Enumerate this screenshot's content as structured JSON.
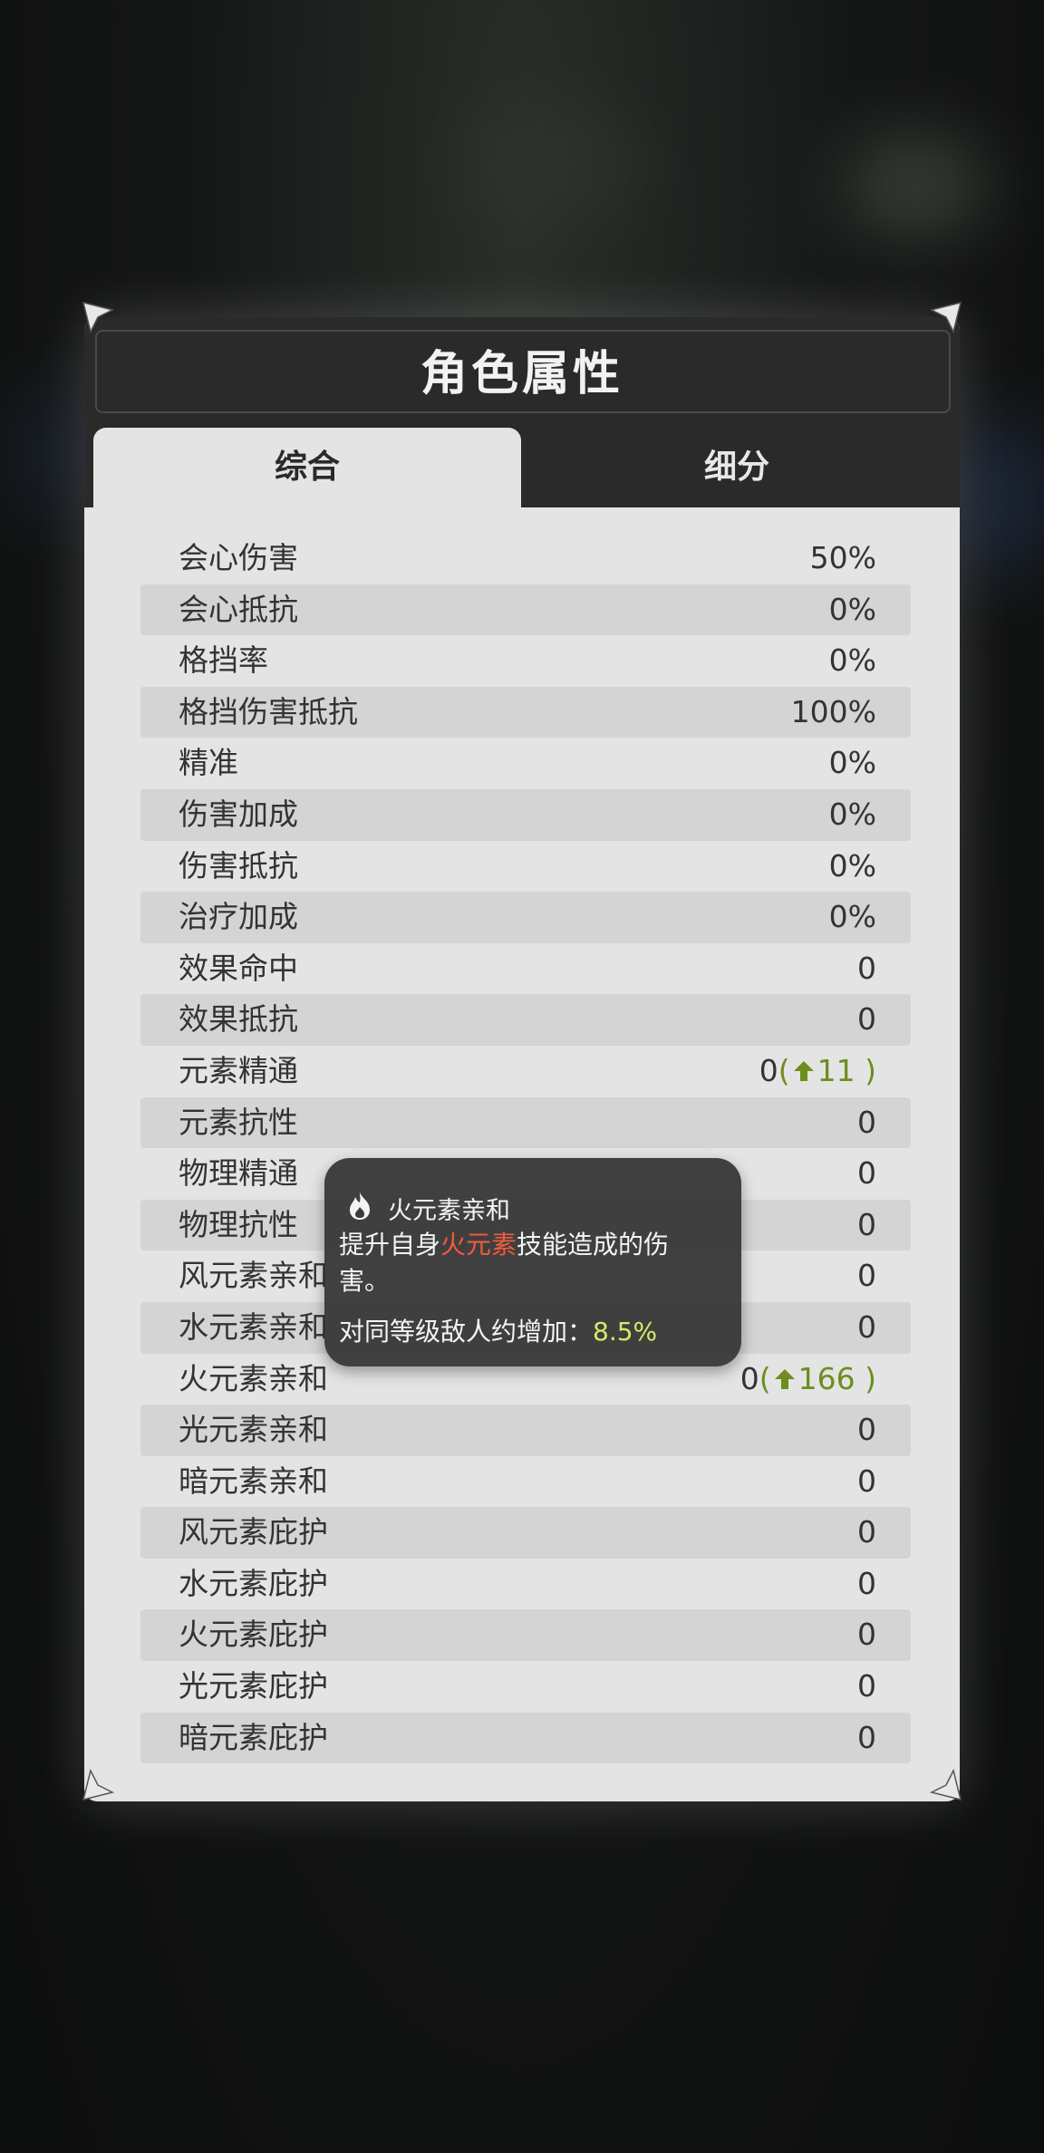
{
  "panel": {
    "title": "角色属性",
    "tabs": [
      {
        "label": "综合",
        "active": true
      },
      {
        "label": "细分",
        "active": false
      }
    ]
  },
  "stats": [
    {
      "label": "会心伤害",
      "value": "50%"
    },
    {
      "label": "会心抵抗",
      "value": "0%"
    },
    {
      "label": "格挡率",
      "value": "0%"
    },
    {
      "label": "格挡伤害抵抗",
      "value": "100%"
    },
    {
      "label": "精准",
      "value": "0%"
    },
    {
      "label": "伤害加成",
      "value": "0%"
    },
    {
      "label": "伤害抵抗",
      "value": "0%"
    },
    {
      "label": "治疗加成",
      "value": "0%"
    },
    {
      "label": "效果命中",
      "value": "0"
    },
    {
      "label": "效果抵抗",
      "value": "0"
    },
    {
      "label": "元素精通",
      "value": "0",
      "bonus": "11"
    },
    {
      "label": "元素抗性",
      "value": "0"
    },
    {
      "label": "物理精通",
      "value": "0"
    },
    {
      "label": "物理抗性",
      "value": "0"
    },
    {
      "label": "风元素亲和",
      "value": "0"
    },
    {
      "label": "水元素亲和",
      "value": "0"
    },
    {
      "label": "火元素亲和",
      "value": "0",
      "bonus": "166"
    },
    {
      "label": "光元素亲和",
      "value": "0"
    },
    {
      "label": "暗元素亲和",
      "value": "0"
    },
    {
      "label": "风元素庇护",
      "value": "0"
    },
    {
      "label": "水元素庇护",
      "value": "0"
    },
    {
      "label": "火元素庇护",
      "value": "0"
    },
    {
      "label": "光元素庇护",
      "value": "0"
    },
    {
      "label": "暗元素庇护",
      "value": "0"
    }
  ],
  "tooltip": {
    "icon": "fire-icon",
    "title": "火元素亲和",
    "desc_prefix": "提升自身",
    "desc_highlight": "火元素",
    "desc_suffix": "技能造成的伤害。",
    "line_label": "对同等级敌人约增加：",
    "line_value": "8.5%"
  },
  "colors": {
    "bonus": "#6d8e1d",
    "fire_highlight": "#f05a3c",
    "tooltip_value": "#d9e86a",
    "header_bg": "#2a2a2a",
    "panel_bg": "#e4e4e4"
  }
}
